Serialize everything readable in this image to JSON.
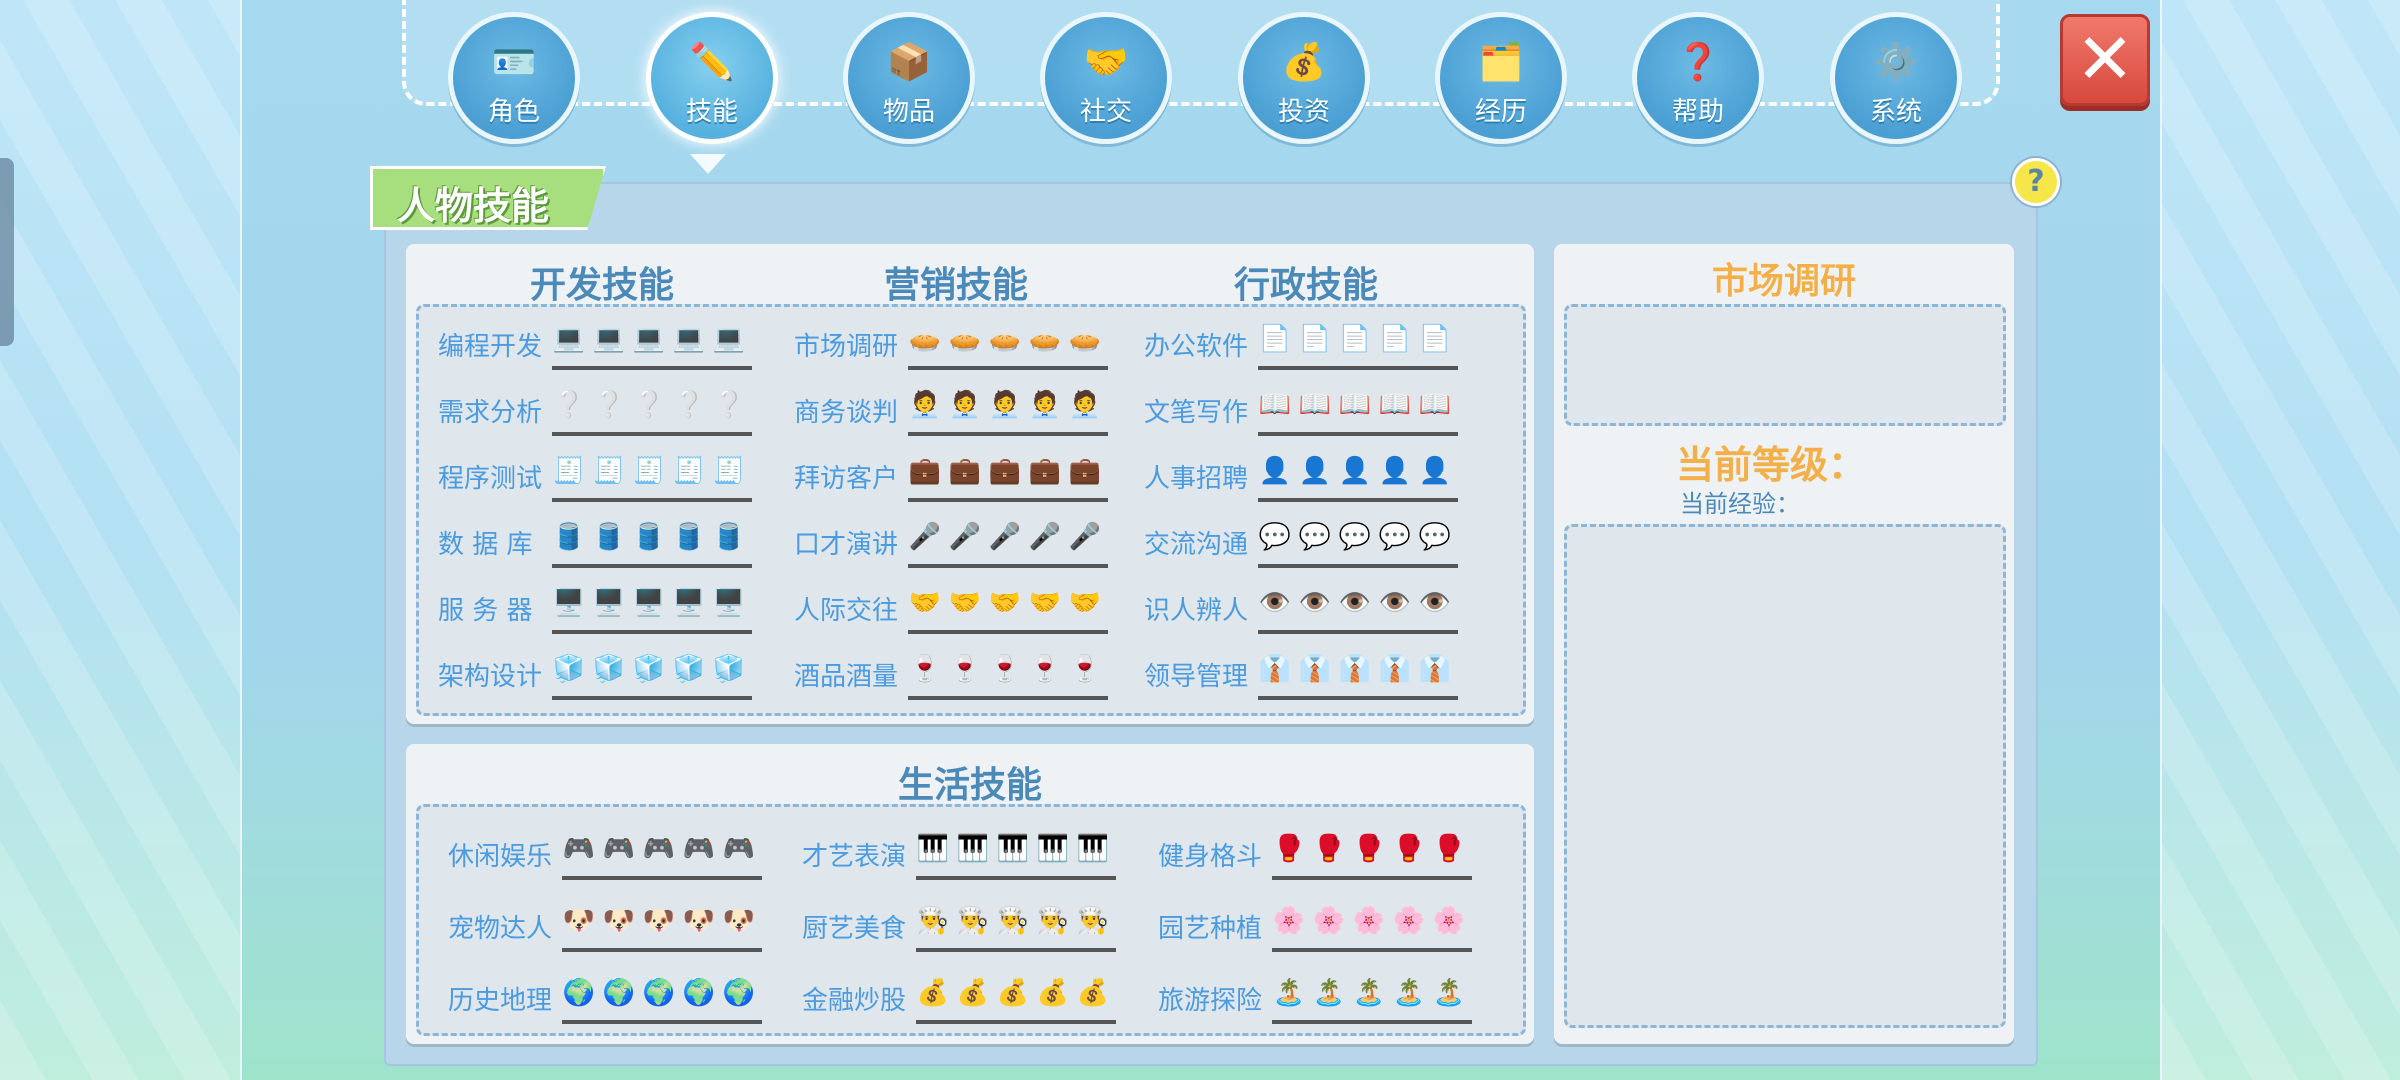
{
  "nav": [
    {
      "label": "角色",
      "icon": "🪪"
    },
    {
      "label": "技能",
      "icon": "✏️"
    },
    {
      "label": "物品",
      "icon": "📦"
    },
    {
      "label": "社交",
      "icon": "🤝"
    },
    {
      "label": "投资",
      "icon": "💰"
    },
    {
      "label": "经历",
      "icon": "🗂️"
    },
    {
      "label": "帮助",
      "icon": "❓"
    },
    {
      "label": "系统",
      "icon": "⚙️"
    }
  ],
  "close_label": "✕",
  "help_label": "?",
  "panel_title": "人物技能",
  "work": {
    "columns": [
      {
        "title": "开发技能",
        "skills": [
          {
            "name": "编程开发",
            "icon": "💻"
          },
          {
            "name": "需求分析",
            "icon": "❔"
          },
          {
            "name": "程序测试",
            "icon": "🧾"
          },
          {
            "name": "数 据 库",
            "icon": "🛢️"
          },
          {
            "name": "服 务 器",
            "icon": "🖥️"
          },
          {
            "name": "架构设计",
            "icon": "🧊"
          }
        ]
      },
      {
        "title": "营销技能",
        "skills": [
          {
            "name": "市场调研",
            "icon": "🥧"
          },
          {
            "name": "商务谈判",
            "icon": "🧑‍💼"
          },
          {
            "name": "拜访客户",
            "icon": "💼"
          },
          {
            "name": "口才演讲",
            "icon": "🎤"
          },
          {
            "name": "人际交往",
            "icon": "🤝"
          },
          {
            "name": "酒品酒量",
            "icon": "🍷"
          }
        ]
      },
      {
        "title": "行政技能",
        "skills": [
          {
            "name": "办公软件",
            "icon": "📄"
          },
          {
            "name": "文笔写作",
            "icon": "📖"
          },
          {
            "name": "人事招聘",
            "icon": "👤"
          },
          {
            "name": "交流沟通",
            "icon": "💬"
          },
          {
            "name": "识人辨人",
            "icon": "👁️"
          },
          {
            "name": "领导管理",
            "icon": "👔"
          }
        ]
      }
    ]
  },
  "life": {
    "title": "生活技能",
    "columns": [
      {
        "skills": [
          {
            "name": "休闲娱乐",
            "icon": "🎮"
          },
          {
            "name": "宠物达人",
            "icon": "🐶"
          },
          {
            "name": "历史地理",
            "icon": "🌍"
          }
        ]
      },
      {
        "skills": [
          {
            "name": "才艺表演",
            "icon": "🎹"
          },
          {
            "name": "厨艺美食",
            "icon": "👨‍🍳"
          },
          {
            "name": "金融炒股",
            "icon": "💰"
          }
        ]
      },
      {
        "skills": [
          {
            "name": "健身格斗",
            "icon": "🥊"
          },
          {
            "name": "园艺种植",
            "icon": "🌸"
          },
          {
            "name": "旅游探险",
            "icon": "🏝️"
          }
        ]
      }
    ]
  },
  "detail": {
    "title": "市场调研",
    "level_label": "当前等级：",
    "exp_label": "当前经验："
  }
}
